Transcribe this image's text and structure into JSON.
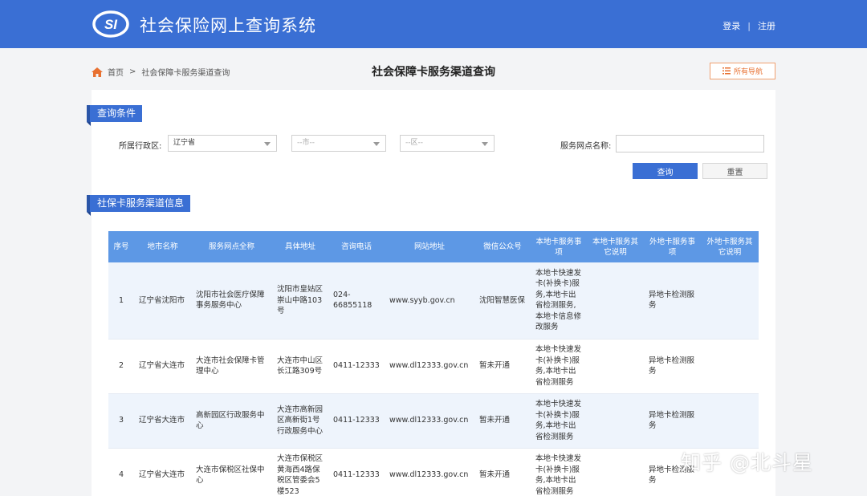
{
  "header": {
    "logo_text": "SI",
    "title": "社会保险网上查询系统",
    "login": "登录",
    "separator": "|",
    "register": "注册"
  },
  "breadcrumb": {
    "home": "首页",
    "arrow": ">",
    "current": "社会保障卡服务渠道查询"
  },
  "page_title": "社会保障卡服务渠道查询",
  "nav_button": "所有导航",
  "query_section": {
    "tag": "查询条件",
    "region_label": "所属行政区:",
    "province": "辽宁省",
    "city_placeholder": "--市--",
    "district_placeholder": "--区--",
    "outlet_label": "服务网点名称:",
    "outlet_value": "",
    "query_button": "查询",
    "reset_button": "重置"
  },
  "results_section": {
    "tag": "社保卡服务渠道信息",
    "headers": [
      "序号",
      "地市名称",
      "服务网点全称",
      "具体地址",
      "咨询电话",
      "网站地址",
      "微信公众号",
      "本地卡服务事项",
      "本地卡服务其它说明",
      "外地卡服务事项",
      "外地卡服务其它说明"
    ],
    "rows": [
      [
        "1",
        "辽宁省沈阳市",
        "沈阳市社会医疗保障事务服务中心",
        "沈阳市皇姑区崇山中路103号",
        "024-66855118",
        "www.syyb.gov.cn",
        "沈阳智慧医保",
        "本地卡快速发卡(补换卡)服务,本地卡出省检测服务,本地卡信息修改服务",
        "",
        "异地卡检测服务",
        ""
      ],
      [
        "2",
        "辽宁省大连市",
        "大连市社会保障卡管理中心",
        "大连市中山区长江路309号",
        "0411-12333",
        "www.dl12333.gov.cn",
        "暂未开通",
        "本地卡快速发卡(补换卡)服务,本地卡出省检测服务",
        "",
        "异地卡检测服务",
        ""
      ],
      [
        "3",
        "辽宁省大连市",
        "高新园区行政服务中心",
        "大连市高新园区高新街1号行政服务中心",
        "0411-12333",
        "www.dl12333.gov.cn",
        "暂未开通",
        "本地卡快速发卡(补换卡)服务,本地卡出省检测服务",
        "",
        "异地卡检测服务",
        ""
      ],
      [
        "4",
        "辽宁省大连市",
        "大连市保税区社保中心",
        "大连市保税区黄海西4路保税区管委会5楼523",
        "0411-12333",
        "www.dl12333.gov.cn",
        "暂未开通",
        "本地卡快速发卡(补换卡)服务,本地卡出省检测服务",
        "",
        "异地卡检测服务",
        ""
      ]
    ]
  },
  "watermark": "知乎 @北斗星",
  "colors": {
    "brand": "#3a6fd4",
    "table_header": "#5d98e5",
    "accent_orange": "#e87030"
  }
}
